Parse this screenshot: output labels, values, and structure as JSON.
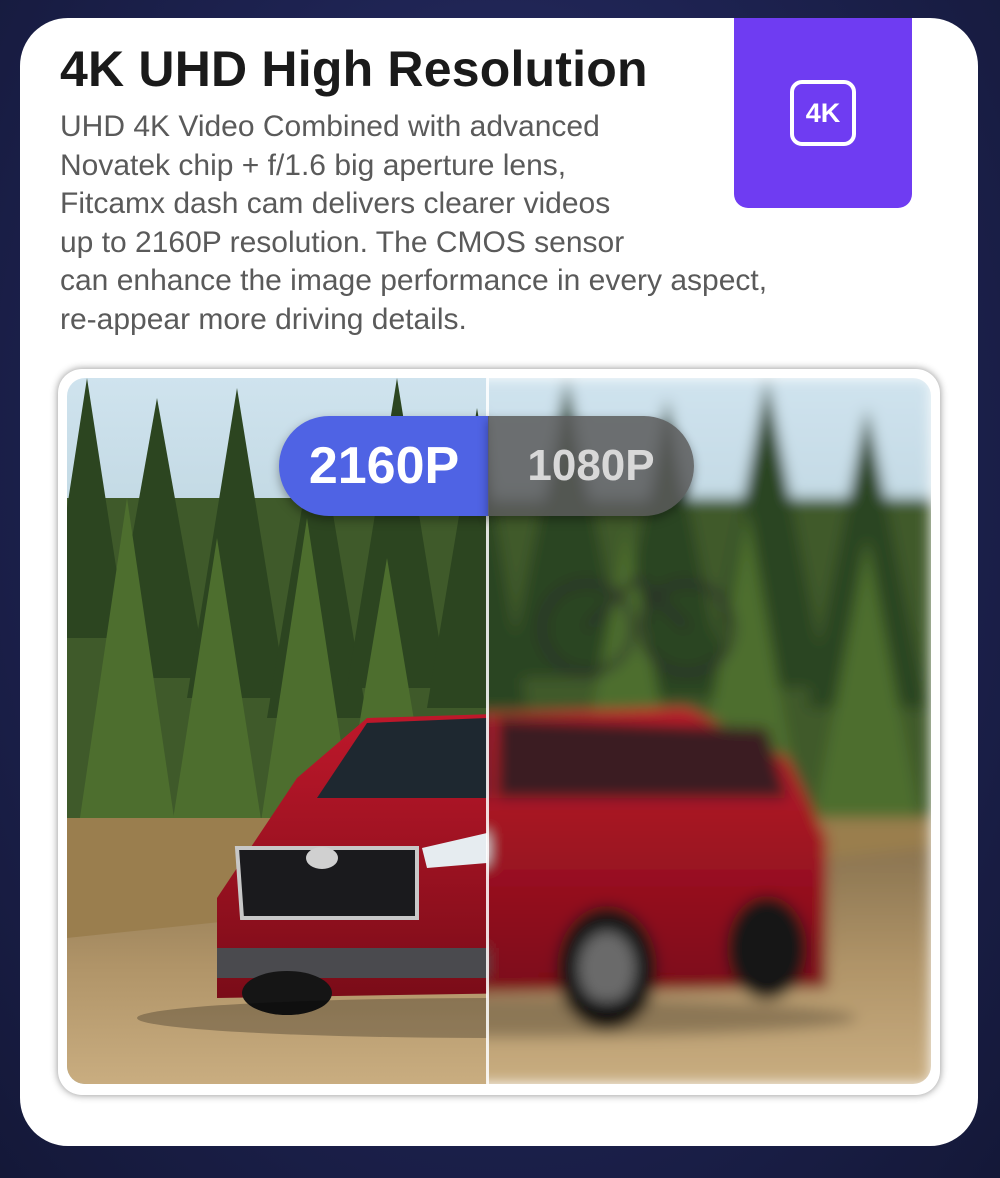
{
  "header": {
    "title": "4K UHD High Resolution",
    "description_lines": [
      "UHD 4K Video Combined with advanced",
      "Novatek chip + f/1.6 big aperture lens,",
      "Fitcamx dash cam delivers clearer videos",
      "up to 2160P resolution. The CMOS sensor",
      "can enhance the image performance in every aspect,",
      "re-appear more driving details."
    ]
  },
  "badge": {
    "icon": "4k-icon",
    "label": "4K",
    "color": "#6f3cf2"
  },
  "comparison": {
    "left_label": "2160P",
    "right_label": "1080P",
    "left_color": "#4f63e4",
    "right_color": "#5a5a5a"
  }
}
